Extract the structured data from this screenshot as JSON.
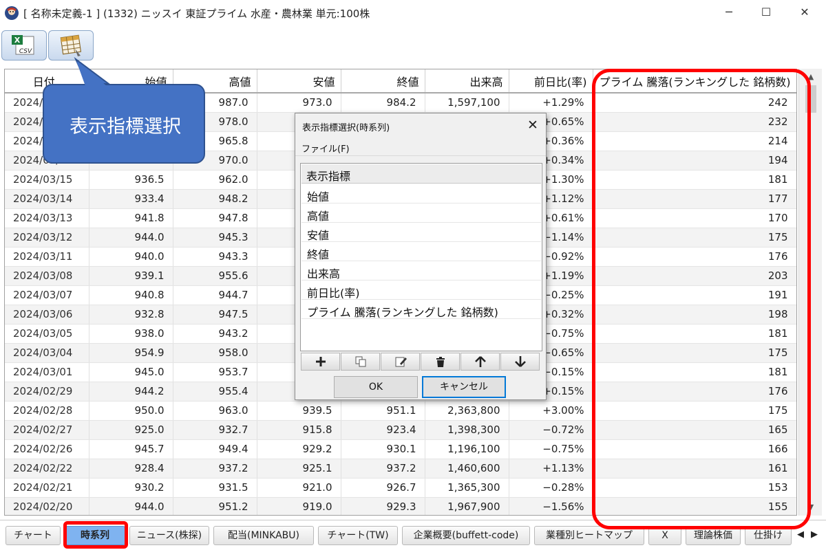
{
  "window": {
    "title": "[ 名称未定義-1 ] (1332) ニッスイ 東証プライム 水産・農林業 単元:100株",
    "minimize": "─",
    "maximize": "☐",
    "close": "✕"
  },
  "toolbar": {
    "csv_label": "CSV"
  },
  "table": {
    "columns": [
      "日付",
      "始値",
      "高値",
      "安値",
      "終値",
      "出来高",
      "前日比(率)",
      "プライム 騰落(ランキングした 銘柄数)"
    ],
    "rows": [
      [
        "2024/03/22",
        "",
        "987.0",
        "973.0",
        "984.2",
        "1,597,100",
        "+1.29%",
        "242"
      ],
      [
        "2024/03/21",
        "",
        "978.0",
        "",
        "",
        "",
        "+0.65%",
        "232"
      ],
      [
        "2024/03/19",
        "",
        "965.8",
        "",
        "",
        "",
        "+0.36%",
        "214"
      ],
      [
        "2024/03/18",
        "",
        "970.0",
        "",
        "",
        "",
        "+0.34%",
        "194"
      ],
      [
        "2024/03/15",
        "936.5",
        "962.0",
        "",
        "",
        "",
        "+1.30%",
        "181"
      ],
      [
        "2024/03/14",
        "933.4",
        "948.2",
        "",
        "",
        "",
        "+1.12%",
        "177"
      ],
      [
        "2024/03/13",
        "941.8",
        "947.8",
        "",
        "",
        "",
        "+0.61%",
        "170"
      ],
      [
        "2024/03/12",
        "944.0",
        "945.3",
        "",
        "",
        "",
        "−1.14%",
        "175"
      ],
      [
        "2024/03/11",
        "940.0",
        "943.3",
        "",
        "",
        "",
        "−0.92%",
        "176"
      ],
      [
        "2024/03/08",
        "939.1",
        "955.6",
        "",
        "",
        "",
        "+1.19%",
        "203"
      ],
      [
        "2024/03/07",
        "940.8",
        "944.7",
        "",
        "",
        "",
        "−0.25%",
        "191"
      ],
      [
        "2024/03/06",
        "932.8",
        "947.5",
        "",
        "",
        "",
        "+0.32%",
        "198"
      ],
      [
        "2024/03/05",
        "938.0",
        "943.2",
        "",
        "",
        "",
        "−0.75%",
        "181"
      ],
      [
        "2024/03/04",
        "954.9",
        "958.0",
        "",
        "",
        "",
        "−0.65%",
        "175"
      ],
      [
        "2024/03/01",
        "945.0",
        "953.7",
        "",
        "",
        "",
        "−0.15%",
        "181"
      ],
      [
        "2024/02/29",
        "944.2",
        "955.4",
        "",
        "",
        "",
        "+0.15%",
        "176"
      ],
      [
        "2024/02/28",
        "950.0",
        "963.0",
        "939.5",
        "951.1",
        "2,363,800",
        "+3.00%",
        "175"
      ],
      [
        "2024/02/27",
        "925.0",
        "932.7",
        "915.8",
        "923.4",
        "1,398,300",
        "−0.72%",
        "165"
      ],
      [
        "2024/02/26",
        "945.7",
        "949.4",
        "929.2",
        "930.1",
        "1,196,100",
        "−0.75%",
        "166"
      ],
      [
        "2024/02/22",
        "928.4",
        "937.2",
        "925.1",
        "937.2",
        "1,460,600",
        "+1.13%",
        "161"
      ],
      [
        "2024/02/21",
        "930.2",
        "931.5",
        "921.0",
        "926.7",
        "1,365,300",
        "−0.28%",
        "153"
      ],
      [
        "2024/02/20",
        "944.0",
        "951.2",
        "919.0",
        "929.3",
        "1,967,900",
        "−1.56%",
        "155"
      ]
    ]
  },
  "callout": {
    "text": "表示指標選択"
  },
  "dialog": {
    "title": "表示指標選択(時系列)",
    "close": "✕",
    "menu_file": "ファイル(F)",
    "list_header": "表示指標",
    "items": [
      "始値",
      "高値",
      "安値",
      "終値",
      "出来高",
      "前日比(率)",
      "プライム 騰落(ランキングした 銘柄数)"
    ],
    "ok": "OK",
    "cancel": "キャンセル"
  },
  "tabs": [
    "チャート",
    "時系列",
    "ニュース(株探)",
    "配当(MINKABU)",
    "チャート(TW)",
    "企業概要(buffett-code)",
    "業種別ヒートマップ",
    "X",
    "理論株価",
    "仕掛け"
  ],
  "active_tab": "時系列",
  "colors": {
    "highlight": "#ff0000",
    "callout": "#4472c4",
    "active_tab": "#7fb3f0"
  }
}
